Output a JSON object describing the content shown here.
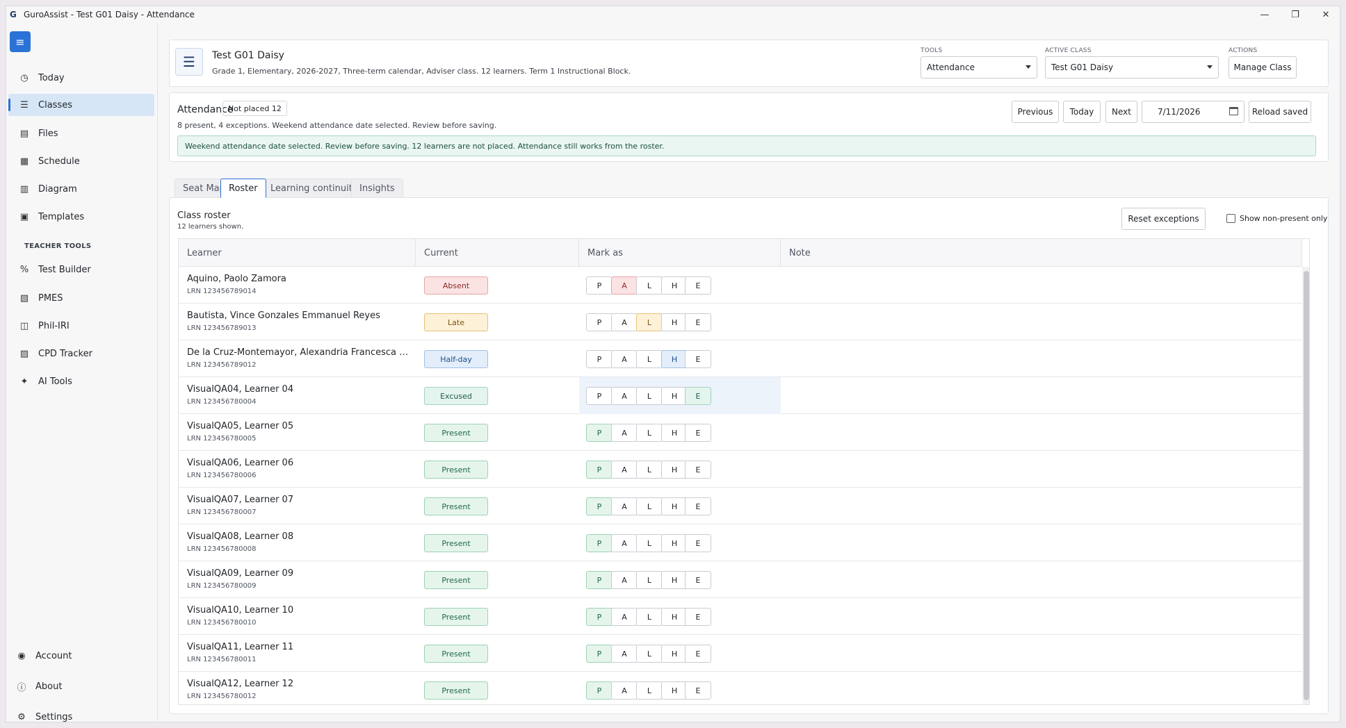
{
  "window": {
    "title": "GuroAssist - Test G01 Daisy - Attendance",
    "logo_glyph": "G",
    "controls": {
      "minimize": "—",
      "restore": "❐",
      "close": "✕"
    }
  },
  "sidebar": {
    "menu_icon": "≡",
    "items": [
      {
        "label": "Today",
        "icon": "clock-icon",
        "glyph": "◷",
        "active": false
      },
      {
        "label": "Classes",
        "icon": "list-icon",
        "glyph": "☰",
        "active": true
      },
      {
        "label": "Files",
        "icon": "file-icon",
        "glyph": "▤",
        "active": false
      },
      {
        "label": "Schedule",
        "icon": "calendar-icon",
        "glyph": "▦",
        "active": false
      },
      {
        "label": "Diagram",
        "icon": "diagram-icon",
        "glyph": "▥",
        "active": false
      },
      {
        "label": "Templates",
        "icon": "template-icon",
        "glyph": "▣",
        "active": false
      }
    ],
    "section_title": "TEACHER TOOLS",
    "tools": [
      {
        "label": "Test Builder",
        "icon": "percent-icon",
        "glyph": "%"
      },
      {
        "label": "PMES",
        "icon": "pmes-icon",
        "glyph": "▧"
      },
      {
        "label": "Phil-IRI",
        "icon": "book-icon",
        "glyph": "◫"
      },
      {
        "label": "CPD Tracker",
        "icon": "tracker-icon",
        "glyph": "▨"
      },
      {
        "label": "AI Tools",
        "icon": "magic-wand-icon",
        "glyph": "✦"
      }
    ],
    "bottom": [
      {
        "label": "Account",
        "icon": "account-icon",
        "glyph": "◉"
      },
      {
        "label": "About",
        "icon": "info-icon",
        "glyph": "ⓘ"
      },
      {
        "label": "Settings",
        "icon": "gear-icon",
        "glyph": "⚙"
      }
    ]
  },
  "header": {
    "class_icon": "☰",
    "class_title": "Test G01 Daisy",
    "class_subtitle": "Grade 1, Elementary, 2026-2027, Three-term calendar, Adviser class. 12 learners. Term 1 Instructional Block.",
    "tools_label": "TOOLS",
    "tools_value": "Attendance",
    "active_class_label": "ACTIVE CLASS",
    "active_class_value": "Test G01 Daisy",
    "actions_label": "ACTIONS",
    "manage_class": "Manage Class"
  },
  "attendance": {
    "title": "Attendance",
    "not_placed_badge": "Not placed 12",
    "summary": "8 present, 4 exceptions. Weekend attendance date selected. Review before saving.",
    "previous": "Previous",
    "today": "Today",
    "next": "Next",
    "date": "7/11/2026",
    "reload": "Reload saved",
    "notice": "Weekend attendance date selected. Review before saving. 12 learners are not placed. Attendance still works from the roster."
  },
  "tabs": [
    "Seat Map",
    "Roster",
    "Learning continuity",
    "Insights"
  ],
  "roster": {
    "title": "Class roster",
    "subtitle": "12 learners shown.",
    "reset": "Reset exceptions",
    "show_non_present": "Show non-present only",
    "columns": [
      "Learner",
      "Current",
      "Mark as",
      "Note"
    ],
    "marks": [
      "P",
      "A",
      "L",
      "H",
      "E"
    ],
    "rows": [
      {
        "name": "Aquino, Paolo Zamora",
        "lrn": "LRN 123456789014",
        "status": "Absent",
        "code": "A"
      },
      {
        "name": "Bautista, Vince Gonzales Emmanuel Reyes",
        "lrn": "LRN 123456789013",
        "status": "Late",
        "code": "L"
      },
      {
        "name": "De la Cruz-Montemayor, Alexandria Francesca S...",
        "lrn": "LRN 123456789012",
        "status": "Half-day",
        "code": "H"
      },
      {
        "name": "VisualQA04, Learner 04",
        "lrn": "LRN 123456780004",
        "status": "Excused",
        "code": "E"
      },
      {
        "name": "VisualQA05, Learner 05",
        "lrn": "LRN 123456780005",
        "status": "Present",
        "code": "P"
      },
      {
        "name": "VisualQA06, Learner 06",
        "lrn": "LRN 123456780006",
        "status": "Present",
        "code": "P"
      },
      {
        "name": "VisualQA07, Learner 07",
        "lrn": "LRN 123456780007",
        "status": "Present",
        "code": "P"
      },
      {
        "name": "VisualQA08, Learner 08",
        "lrn": "LRN 123456780008",
        "status": "Present",
        "code": "P"
      },
      {
        "name": "VisualQA09, Learner 09",
        "lrn": "LRN 123456780009",
        "status": "Present",
        "code": "P"
      },
      {
        "name": "VisualQA10, Learner 10",
        "lrn": "LRN 123456780010",
        "status": "Present",
        "code": "P"
      },
      {
        "name": "VisualQA11, Learner 11",
        "lrn": "LRN 123456780011",
        "status": "Present",
        "code": "P"
      },
      {
        "name": "VisualQA12, Learner 12",
        "lrn": "LRN 123456780012",
        "status": "Present",
        "code": "P"
      }
    ]
  },
  "colors": {
    "accent": "#2b72d6",
    "notice_bg": "#eaf6f1",
    "present": "#e6f5ec",
    "absent": "#fbe3e3",
    "late": "#fdf1d8",
    "halfday": "#e3eefa"
  }
}
